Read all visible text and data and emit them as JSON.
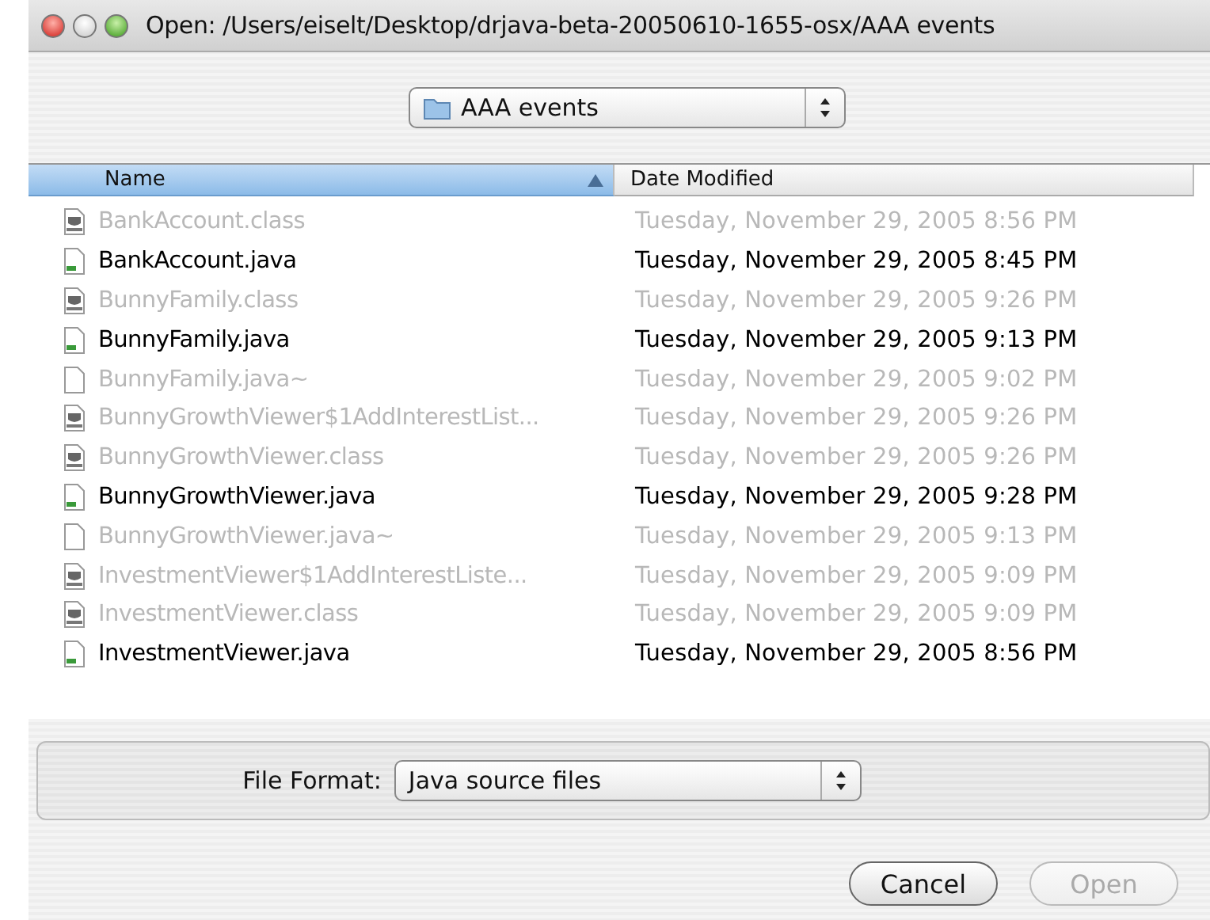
{
  "window": {
    "title": "Open:  /Users/eiselt/Desktop/drjava-beta-20050610-1655-osx/AAA events"
  },
  "location": {
    "value": "AAA events"
  },
  "columns": [
    {
      "label": "Name",
      "selected": true,
      "sorted_ascending": true
    },
    {
      "label": "Date Modified",
      "selected": false
    }
  ],
  "files": [
    {
      "name": "BankAccount.class",
      "date": "Tuesday, November 29, 2005 8:56 PM",
      "kind": "class",
      "disabled": true
    },
    {
      "name": "BankAccount.java",
      "date": "Tuesday, November 29, 2005 8:45 PM",
      "kind": "java",
      "disabled": false
    },
    {
      "name": "BunnyFamily.class",
      "date": "Tuesday, November 29, 2005 9:26 PM",
      "kind": "class",
      "disabled": true
    },
    {
      "name": "BunnyFamily.java",
      "date": "Tuesday, November 29, 2005 9:13 PM",
      "kind": "java",
      "disabled": false
    },
    {
      "name": "BunnyFamily.java~",
      "date": "Tuesday, November 29, 2005 9:02 PM",
      "kind": "text",
      "disabled": true
    },
    {
      "name": "BunnyGrowthViewer$1AddInterestList...",
      "date": "Tuesday, November 29, 2005 9:26 PM",
      "kind": "class",
      "disabled": true
    },
    {
      "name": "BunnyGrowthViewer.class",
      "date": "Tuesday, November 29, 2005 9:26 PM",
      "kind": "class",
      "disabled": true
    },
    {
      "name": "BunnyGrowthViewer.java",
      "date": "Tuesday, November 29, 2005 9:28 PM",
      "kind": "java",
      "disabled": false
    },
    {
      "name": "BunnyGrowthViewer.java~",
      "date": "Tuesday, November 29, 2005 9:13 PM",
      "kind": "text",
      "disabled": true
    },
    {
      "name": "InvestmentViewer$1AddInterestListe...",
      "date": "Tuesday, November 29, 2005 9:09 PM",
      "kind": "class",
      "disabled": true
    },
    {
      "name": "InvestmentViewer.class",
      "date": "Tuesday, November 29, 2005 9:09 PM",
      "kind": "class",
      "disabled": true
    },
    {
      "name": "InvestmentViewer.java",
      "date": "Tuesday, November 29, 2005 8:56 PM",
      "kind": "java",
      "disabled": false
    }
  ],
  "file_format": {
    "label": "File Format:",
    "value": "Java source files"
  },
  "buttons": [
    {
      "label": "Cancel",
      "disabled": false
    },
    {
      "label": "Open",
      "disabled": true
    }
  ]
}
